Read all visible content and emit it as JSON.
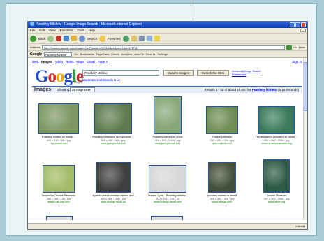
{
  "window": {
    "title": "Powdery Mildew - Google Image Search - Microsoft Internet Explorer",
    "menu": [
      "File",
      "Edit",
      "View",
      "Favorites",
      "Tools",
      "Help"
    ]
  },
  "toolbar": {
    "back_label": "Back",
    "search_label": "Search",
    "favorites_label": "Favorites"
  },
  "address": {
    "label": "Address",
    "url": "http://images.google.com/images?q=Powdery%20Mildew&um=1&ie=UTF-8",
    "go_label": "Go",
    "links_label": "Links"
  },
  "google_toolbar": {
    "prefix": "Google",
    "query": "Powdery Mildew",
    "go_label": "Go",
    "items": [
      "Bookmarks",
      "PageRank",
      "Check",
      "AutoLink",
      "AutoFill",
      "Send to",
      "Settings"
    ]
  },
  "nav": {
    "links": [
      "Web",
      "Images",
      "Video",
      "News",
      "Maps",
      "Gmail",
      "more »"
    ],
    "active_index": 1,
    "sign_in": "Sign in"
  },
  "search": {
    "logo_letters": [
      "G",
      "o",
      "o",
      "g",
      "l",
      "e"
    ],
    "logo_sub": "Images",
    "query": "Powdery Mildew",
    "search_images_label": "Search Images",
    "search_web_label": "Search the Web",
    "advanced_link": "Advanced Image Search",
    "preferences_link": "Preferences",
    "safesearch": "Moderate SafeSearch is on"
  },
  "results_bar": {
    "title": "Images",
    "showing": "Showing:",
    "size_select": "All image sizes",
    "summary_prefix": "Results 1 - 20 of about 16,500 for",
    "query_link": "Powdery Mildew",
    "summary_suffix": ". (0.16 seconds)"
  },
  "results": [
    {
      "title": "Powdery mildew on easily ...",
      "meta": "640 x 512 - 58k - jpg",
      "url": "hfp.cornell.edu",
      "color": "#7d9763"
    },
    {
      "title": "Powdery mildew on honeysuckle ...",
      "meta": "650 x 488 - 46k - jpg",
      "url": "www.ppdl.purdue.edu",
      "color": "#5f7c50"
    },
    {
      "title": "Powdery mildew on phlox",
      "meta": "414 x 555 - 140k - jpg",
      "url": "www.ppdl.purdue.edu",
      "color": "#87a776"
    },
    {
      "title": "Powdery Mildew",
      "meta": "251 x 224 - 20k - jpg",
      "url": "ipm.ucdavis.edu",
      "color": "#6f8d55"
    },
    {
      "title": "The disease is prevalent in humid ...",
      "meta": "450 x 347 - 200k - jpg",
      "url": "www.umassvegetable.org",
      "color": "#3b7b5b"
    },
    {
      "title": "Grapevine Decline Research",
      "meta": "288 x 288 - 18k - jpg",
      "url": "grape.cas.psu.edu",
      "color": "#a4bb68"
    },
    {
      "title": "... against wheat powdery mildew and ...",
      "meta": "525 x 604 - 166k - jpg",
      "url": "www.biology.ed.ac.uk",
      "color": "#3f3f3f"
    },
    {
      "title": "Disease Cycle - Powdery mildew ...",
      "meta": "500 x 321 - 21k - gif",
      "url": "www.botany.hawaii.edu",
      "color": "#d7d7d7"
    },
    {
      "title": "powdery mildew in wheat",
      "meta": "300 x 300 - 32k - jpg",
      "url": "www.bbrags.com",
      "color": "#44513a"
    },
    {
      "title": "Tomato Diseases",
      "meta": "307 x 505 - 196k - jpg",
      "url": "www.ianrtr.org",
      "color": "#2e5b45"
    }
  ],
  "status": {
    "zone": "Internet"
  }
}
